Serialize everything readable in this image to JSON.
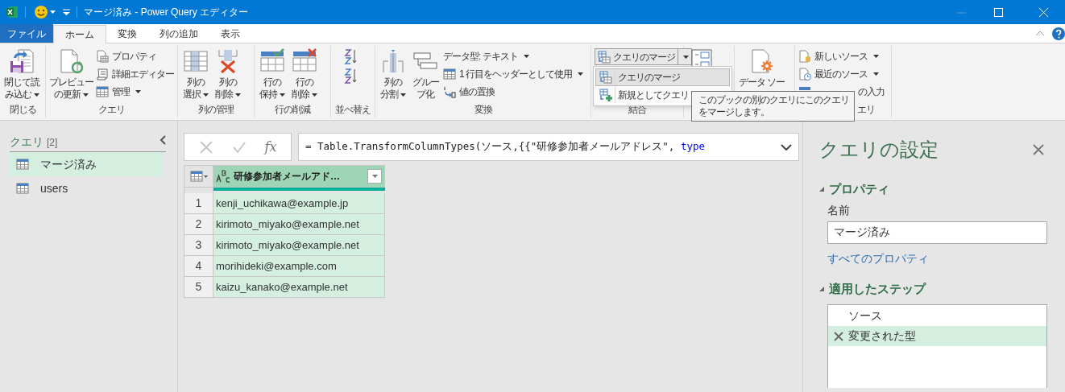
{
  "window": {
    "title": "マージ済み - Power Query エディター"
  },
  "tabs": [
    {
      "label": "ファイル",
      "kind": "file",
      "selected": false
    },
    {
      "label": "ホーム",
      "kind": "tab",
      "selected": true
    },
    {
      "label": "変換",
      "kind": "tab",
      "selected": false
    },
    {
      "label": "列の追加",
      "kind": "tab",
      "selected": false
    },
    {
      "label": "表示",
      "kind": "tab",
      "selected": false
    }
  ],
  "ribbon": {
    "groups": [
      {
        "label": "閉じる",
        "items": [
          {
            "kind": "large",
            "lines": [
              "閉じて読",
              "み込む"
            ],
            "dropdown": true
          }
        ]
      },
      {
        "label": "クエリ",
        "items": [
          {
            "kind": "large",
            "lines": [
              "プレビュー",
              "の更新"
            ],
            "dropdown": true
          },
          {
            "kind": "stack",
            "entries": [
              {
                "label": "プロパティ",
                "dropdown": false
              },
              {
                "label": "詳細エディター",
                "dropdown": false
              },
              {
                "label": "管理",
                "dropdown": true
              }
            ]
          }
        ]
      },
      {
        "label": "列の管理",
        "items": [
          {
            "kind": "large",
            "lines": [
              "列の",
              "選択"
            ],
            "dropdown": true
          },
          {
            "kind": "large",
            "lines": [
              "列の",
              "削除"
            ],
            "dropdown": true
          }
        ]
      },
      {
        "label": "行の削減",
        "items": [
          {
            "kind": "large",
            "lines": [
              "行の",
              "保持"
            ],
            "dropdown": true
          },
          {
            "kind": "large",
            "lines": [
              "行の",
              "削除"
            ],
            "dropdown": true
          }
        ]
      },
      {
        "label": "並べ替え",
        "items": [
          {
            "kind": "sort"
          }
        ]
      },
      {
        "label": "変換",
        "items": [
          {
            "kind": "large",
            "lines": [
              "列の",
              "分割"
            ],
            "dropdown": true
          },
          {
            "kind": "large",
            "lines": [
              "グルー",
              "プ化"
            ],
            "dropdown": false
          },
          {
            "kind": "stack",
            "entries": [
              {
                "label": "データ型: テキスト",
                "dropdown": true
              },
              {
                "label": "1 行目をヘッダーとして使用",
                "dropdown": true
              },
              {
                "label": "値の置換",
                "dropdown": false
              }
            ]
          }
        ]
      },
      {
        "label": "結合",
        "items": [
          {
            "kind": "split",
            "label": "クエリのマージ",
            "open": true
          }
        ]
      },
      {
        "items": [
          {
            "kind": "icon_only"
          }
        ]
      },
      {
        "items": [
          {
            "kind": "large",
            "lines": [
              "データ ソー"
            ],
            "dropdown": false
          }
        ]
      },
      {
        "label": "エリ",
        "label_partial": true,
        "items": [
          {
            "kind": "stack",
            "entries": [
              {
                "label": "新しいソース",
                "dropdown": true
              },
              {
                "label": "最近のソース",
                "dropdown": true
              },
              {
                "label": "の入力",
                "dropdown": false,
                "partial": true
              }
            ]
          }
        ]
      }
    ]
  },
  "merge_menu": {
    "items": [
      {
        "label": "クエリのマージ",
        "selected": true
      },
      {
        "label": "新規としてクエリ",
        "selected": false
      }
    ]
  },
  "tooltip": {
    "lines": [
      "このブックの別のクエリにこのクエリ",
      "をマージします。"
    ]
  },
  "queries": {
    "title": "クエリ",
    "count": "[2]",
    "items": [
      {
        "label": "マージ済み",
        "selected": true
      },
      {
        "label": "users",
        "selected": false
      }
    ]
  },
  "formula_bar": {
    "fx": "fx",
    "formula": [
      {
        "kind": "code",
        "text": "= Table.TransformColumnTypes(ソース,{{\"研修参加者メールアドレス\", "
      },
      {
        "kind": "keyword",
        "text": "type"
      }
    ]
  },
  "table": {
    "columns": [
      {
        "label": "研修参加者メールアド…"
      }
    ],
    "rows": [
      {
        "index": "1",
        "value": "kenji_uchikawa@example.jp"
      },
      {
        "index": "2",
        "value": "kirimoto_miyako@example.net"
      },
      {
        "index": "3",
        "value": "kirimoto_miyako@example.net"
      },
      {
        "index": "4",
        "value": "morihideki@example.com"
      },
      {
        "index": "5",
        "value": "kaizu_kanako@example.net"
      }
    ]
  },
  "settings": {
    "title": "クエリの設定",
    "properties_heading": "プロパティ",
    "name_label": "名前",
    "name_value": "マージ済み",
    "all_properties_link": "すべてのプロパティ",
    "steps_heading": "適用したステップ",
    "steps": [
      {
        "label": "ソース",
        "selected": false
      },
      {
        "label": "変更された型",
        "selected": true
      }
    ]
  }
}
